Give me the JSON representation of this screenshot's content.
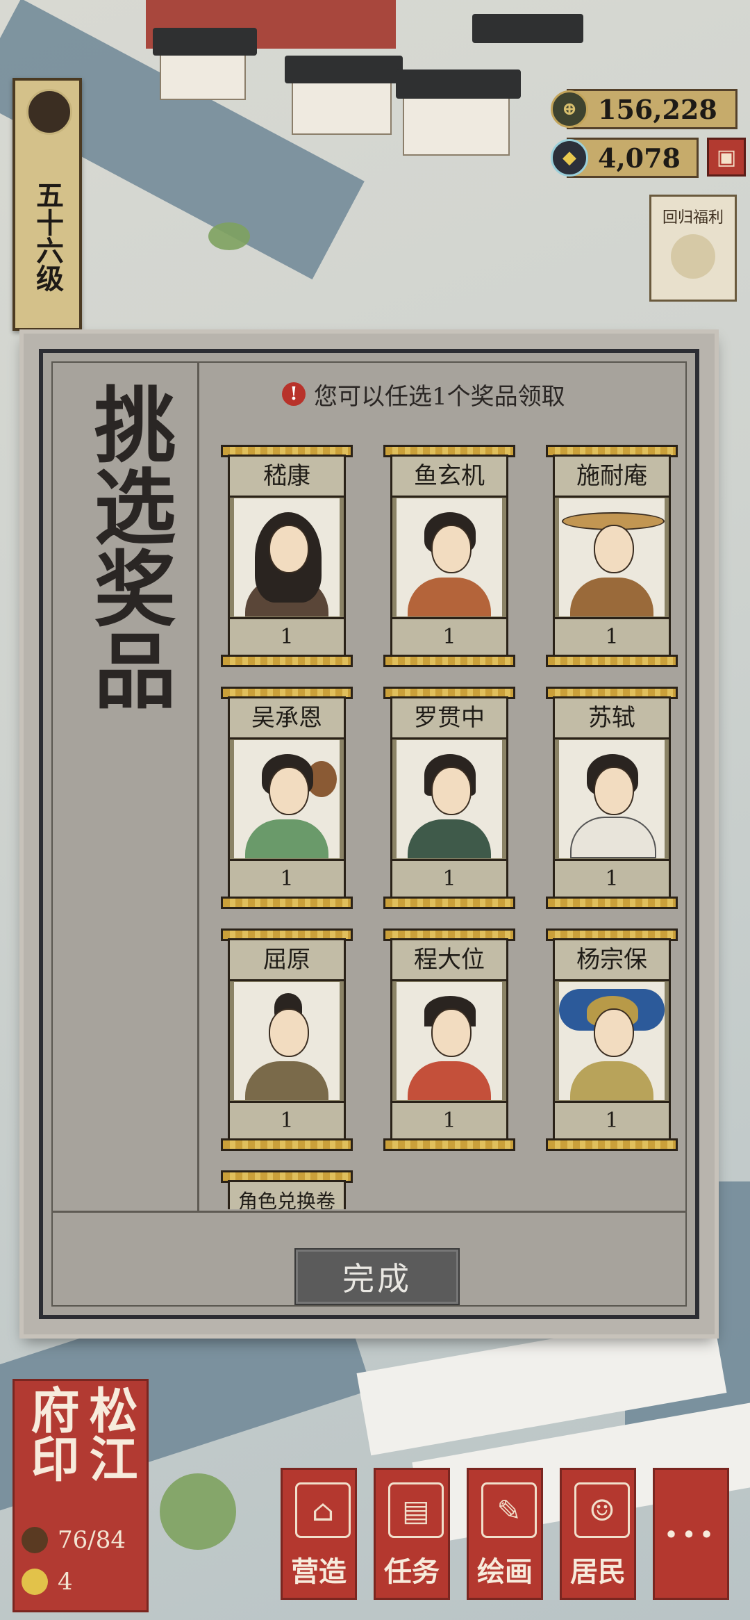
{
  "level": {
    "text": "五十六级"
  },
  "resources": {
    "coins": "156,228",
    "jade": "4,078"
  },
  "side_banner": {
    "text": "回归福利"
  },
  "dialog": {
    "title": "挑选奖品",
    "hint_icon": "!",
    "hint": "您可以任选1个奖品领取",
    "rewards": [
      {
        "name": "嵇康",
        "qty": "1"
      },
      {
        "name": "鱼玄机",
        "qty": "1"
      },
      {
        "name": "施耐庵",
        "qty": "1"
      },
      {
        "name": "吴承恩",
        "qty": "1"
      },
      {
        "name": "罗贯中",
        "qty": "1"
      },
      {
        "name": "苏轼",
        "qty": "1"
      },
      {
        "name": "屈原",
        "qty": "1"
      },
      {
        "name": "程大位",
        "qty": "1"
      },
      {
        "name": "杨宗保",
        "qty": "1"
      },
      {
        "name": "角色兑换卷",
        "qty": ""
      }
    ],
    "done_label": "完成"
  },
  "seal": {
    "title": "松江府印",
    "population": "76/84",
    "happiness": "4"
  },
  "nav": [
    {
      "label": "营造",
      "icon": "building-icon"
    },
    {
      "label": "任务",
      "icon": "task-book-icon"
    },
    {
      "label": "绘画",
      "icon": "scroll-icon"
    },
    {
      "label": "居民",
      "icon": "resident-icon"
    },
    {
      "label": "···",
      "icon": "more-icon"
    }
  ],
  "colors": {
    "seal_red": "#b23a32",
    "card_gold": "#caa03a",
    "panel_gray": "#a7a39c",
    "done_gray": "#5b5b5b"
  }
}
